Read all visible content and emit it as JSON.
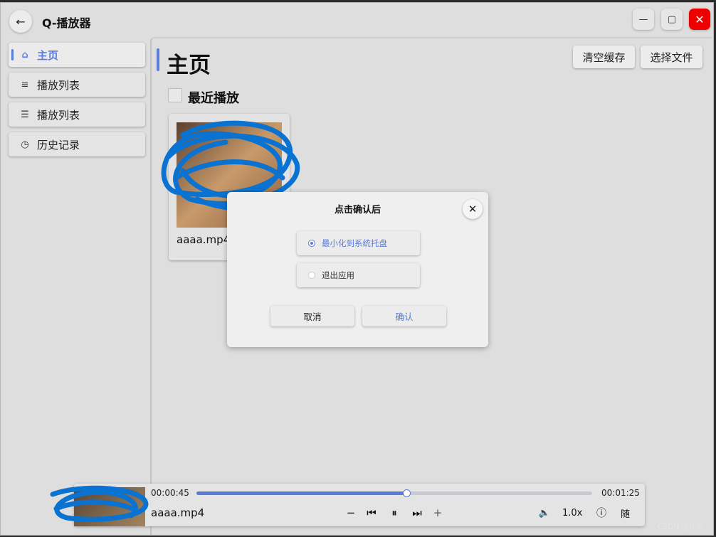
{
  "window": {
    "title": "Q-播放器",
    "back_icon": "←",
    "min_icon": "—",
    "max_icon": "▢",
    "close_icon": "✕",
    "close_color": "#ee0000"
  },
  "sidebar": {
    "items": [
      {
        "label": "主页",
        "icon": "⌂",
        "active": true
      },
      {
        "label": "播放列表",
        "icon": "≡"
      },
      {
        "label": "播放列表",
        "icon": "☰"
      },
      {
        "label": "历史记录",
        "icon": "◷"
      }
    ],
    "accent_color": "#5b7bd8"
  },
  "main": {
    "title": "主页",
    "clear_cache_label": "清空缓存",
    "choose_file_label": "选择文件",
    "recent_label": "最近播放",
    "recent_items": [
      {
        "name": "aaaa.mp4"
      }
    ]
  },
  "dialog": {
    "title": "点击确认后",
    "close_icon": "✕",
    "options": [
      {
        "label": "最小化到系统托盘",
        "selected": true
      },
      {
        "label": "退出应用",
        "selected": false
      }
    ],
    "cancel_label": "取消",
    "confirm_label": "确认"
  },
  "player": {
    "current_time": "00:00:45",
    "total_time": "00:01:25",
    "progress": 0.53,
    "file_name": "aaaa.mp4",
    "minus_icon": "−",
    "prev_icon": "⏮",
    "pause_icon": "⏸",
    "next_icon": "⏭",
    "plus_icon": "+",
    "volume_icon": "🔈",
    "speed": "1.0x",
    "info_icon": "ⓘ",
    "shuffle_label": "随"
  },
  "watermark": "CSDN @仟白"
}
